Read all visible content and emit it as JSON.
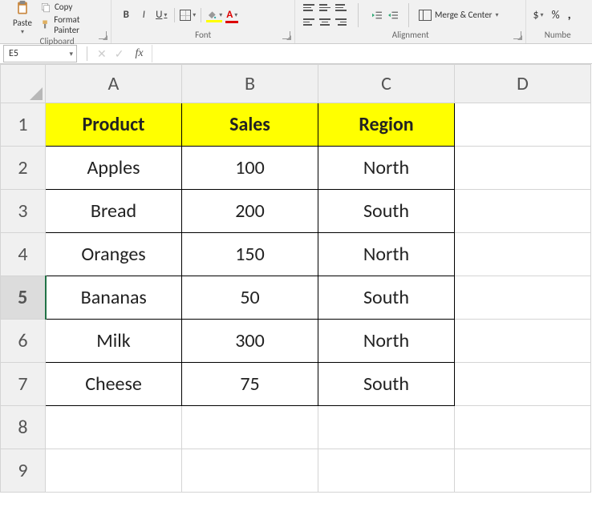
{
  "ribbon": {
    "clipboard": {
      "paste_label": "Paste",
      "copy_label": "Copy",
      "format_painter_label": "Format Painter",
      "group_label": "Clipboard"
    },
    "font": {
      "bold": "B",
      "italic": "I",
      "underline": "U",
      "group_label": "Font"
    },
    "alignment": {
      "merge_label": "Merge & Center",
      "group_label": "Alignment"
    },
    "number": {
      "dollar": "$",
      "percent": "%",
      "comma": ",",
      "group_label": "Numbe"
    }
  },
  "name_box": "E5",
  "formula_bar_value": "",
  "selected_cell": "E5",
  "columns": [
    "A",
    "B",
    "C",
    "D"
  ],
  "rows": [
    "1",
    "2",
    "3",
    "4",
    "5",
    "6",
    "7",
    "8",
    "9"
  ],
  "active_row": "5",
  "headers": {
    "A": "Product",
    "B": "Sales",
    "C": "Region"
  },
  "data": [
    {
      "A": "Apples",
      "B": "100",
      "C": "North"
    },
    {
      "A": "Bread",
      "B": "200",
      "C": "South"
    },
    {
      "A": "Oranges",
      "B": "150",
      "C": "North"
    },
    {
      "A": "Bananas",
      "B": "50",
      "C": "South"
    },
    {
      "A": "Milk",
      "B": "300",
      "C": "North"
    },
    {
      "A": "Cheese",
      "B": "75",
      "C": "South"
    }
  ]
}
